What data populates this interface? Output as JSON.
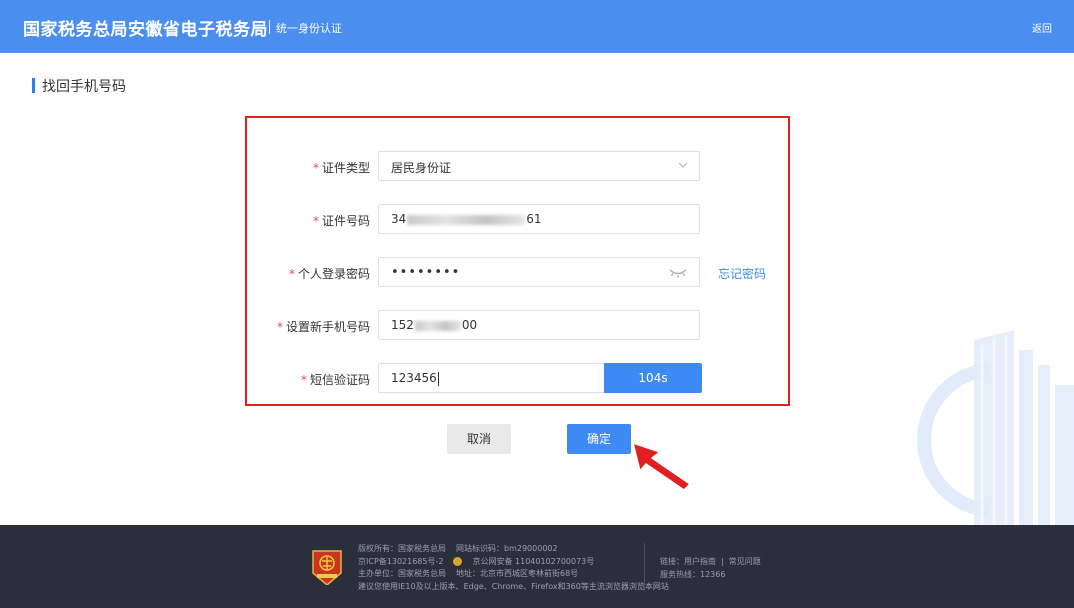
{
  "header": {
    "brand": "国家税务总局安徽省电子税务局",
    "subtitle": "统一身份认证",
    "back_label": "返回"
  },
  "section": {
    "title": "找回手机号码"
  },
  "form": {
    "id_type": {
      "label": "证件类型",
      "value": "居民身份证"
    },
    "id_number": {
      "label": "证件号码",
      "value_prefix": "34",
      "value_suffix": "61"
    },
    "password": {
      "label": "个人登录密码",
      "value": "••••••••",
      "forget_label": "忘记密码"
    },
    "new_phone": {
      "label": "设置新手机号码",
      "value_prefix": "152",
      "value_suffix": "00"
    },
    "sms_code": {
      "label": "短信验证码",
      "value": "123456",
      "countdown_label": "104s"
    }
  },
  "actions": {
    "cancel_label": "取消",
    "confirm_label": "确定"
  },
  "footer": {
    "copyright": "版权所有：国家税务总局",
    "site_code": "网站标识码：bm29000002",
    "icp": "京ICP备13021685号-2",
    "police": "京公网安备 11040102700073号",
    "sponsor": "主办单位：国家税务总局",
    "address": "地址：北京市西城区枣林前街68号",
    "browser_tip": "建议您使用IE10及以上版本、Edge、Chrome、Firefox和360等主流浏览器浏览本网站",
    "links_label": "链接：",
    "link_guide": "用户指南",
    "link_faq": "常见问题",
    "hotline": "服务热线：12366"
  },
  "colors": {
    "header_bg": "#4a8ef0",
    "primary": "#3d8af5",
    "annotation": "#e02020",
    "footer_bg": "#2a2f3a"
  }
}
